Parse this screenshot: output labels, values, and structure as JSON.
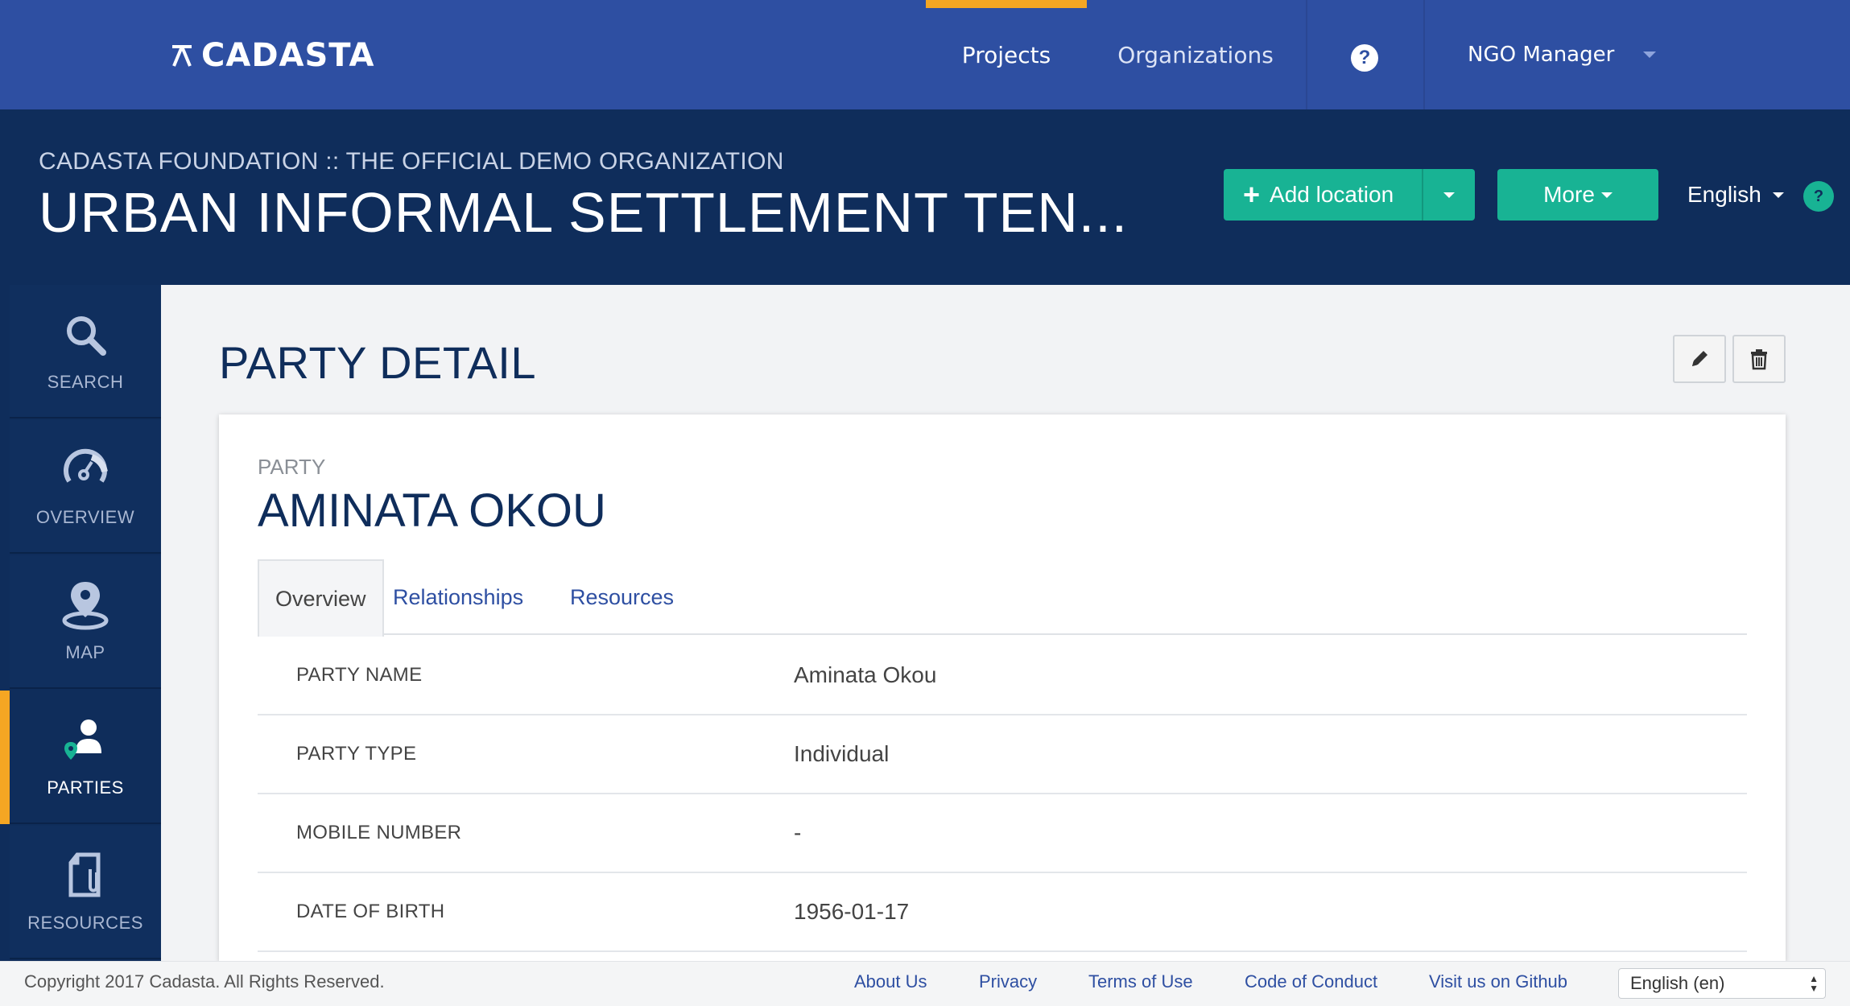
{
  "brand": {
    "name": "CADASTA"
  },
  "topnav": {
    "projects": "Projects",
    "organizations": "Organizations",
    "help": "?",
    "user": "NGO Manager"
  },
  "project_header": {
    "org": "CADASTA FOUNDATION :: THE OFFICIAL DEMO ORGANIZATION",
    "project": "URBAN INFORMAL SETTLEMENT TEN...",
    "add_location": "Add location",
    "more": "More",
    "language": "English",
    "help": "?"
  },
  "sidebar": {
    "items": [
      {
        "label": "SEARCH",
        "icon": "search-icon"
      },
      {
        "label": "OVERVIEW",
        "icon": "dashboard-icon"
      },
      {
        "label": "MAP",
        "icon": "map-pin-icon"
      },
      {
        "label": "PARTIES",
        "icon": "person-pin-icon",
        "active": true
      },
      {
        "label": "RESOURCES",
        "icon": "file-attachment-icon"
      }
    ]
  },
  "main": {
    "title": "PARTY DETAIL",
    "party_label": "PARTY",
    "party_name": "AMINATA OKOU",
    "tabs": [
      {
        "label": "Overview",
        "active": true
      },
      {
        "label": "Relationships"
      },
      {
        "label": "Resources"
      }
    ],
    "fields": [
      {
        "key": "PARTY NAME",
        "value": "Aminata Okou"
      },
      {
        "key": "PARTY TYPE",
        "value": "Individual"
      },
      {
        "key": "MOBILE NUMBER",
        "value": "-"
      },
      {
        "key": "DATE OF BIRTH",
        "value": "1956-01-17"
      }
    ]
  },
  "footer": {
    "copyright": "Copyright 2017 Cadasta. All Rights Reserved.",
    "links": [
      "About Us",
      "Privacy",
      "Terms of Use",
      "Code of Conduct",
      "Visit us on Github"
    ],
    "language_select": "English (en)"
  },
  "colors": {
    "nav_blue": "#2e4fa2",
    "header_navy": "#0f2d5b",
    "accent_green": "#18b394",
    "active_orange": "#f5a623"
  }
}
